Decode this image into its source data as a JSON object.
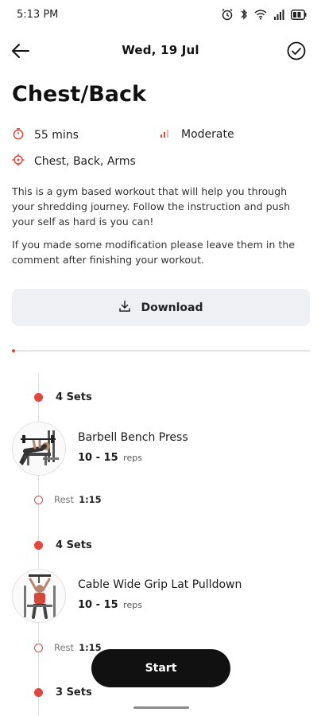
{
  "status_bar": {
    "time": "5:13 PM",
    "icons": [
      "alarm-icon",
      "bluetooth-icon",
      "wifi-icon",
      "signal-icon",
      "battery-icon"
    ]
  },
  "header": {
    "date": "Wed, 19 Jul",
    "back_icon": "arrow-left-icon",
    "complete_icon": "check-circle-icon"
  },
  "workout": {
    "title": "Chest/Back",
    "duration": "55 mins",
    "intensity": "Moderate",
    "muscles": "Chest, Back, Arms",
    "description_1": "This is a gym based workout that will help you through your shredding journey. Follow the instruction and push your self as hard is you can!",
    "description_2": "If you made some modification please leave them in the comment after finishing your workout.",
    "download_label": "Download",
    "progress_fraction": 0.01
  },
  "exercises": [
    {
      "sets": "4 Sets",
      "name": "Barbell Bench Press",
      "reps": "10 - 15",
      "reps_unit": "reps",
      "rest_label": "Rest",
      "rest_time": "1:15"
    },
    {
      "sets": "4 Sets",
      "name": "Cable Wide Grip Lat Pulldown",
      "reps": "10 - 15",
      "reps_unit": "reps",
      "rest_label": "Rest",
      "rest_time": "1:15"
    },
    {
      "sets": "3 Sets"
    }
  ],
  "actions": {
    "start_label": "Start"
  },
  "colors": {
    "accent": "#e8443a",
    "button_dark": "#111111",
    "download_bg": "#eef0f3"
  }
}
